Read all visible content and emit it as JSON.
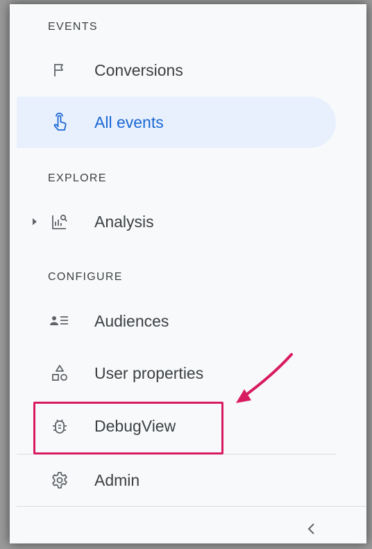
{
  "sections": {
    "events": "EVENTS",
    "explore": "EXPLORE",
    "configure": "CONFIGURE"
  },
  "nav": {
    "conversions": {
      "label": "Conversions",
      "icon": "flag-icon"
    },
    "all_events": {
      "label": "All events",
      "icon": "touch-icon",
      "active": true
    },
    "analysis": {
      "label": "Analysis",
      "icon": "analysis-icon"
    },
    "audiences": {
      "label": "Audiences",
      "icon": "audience-list-icon"
    },
    "user_properties": {
      "label": "User properties",
      "icon": "shapes-icon"
    },
    "debugview": {
      "label": "DebugView",
      "icon": "bug-icon"
    },
    "admin": {
      "label": "Admin",
      "icon": "gear-icon"
    }
  },
  "colors": {
    "active_bg": "#e8f0fe",
    "active_text": "#1967d2",
    "highlight": "#d81b60",
    "text": "#3c4043"
  }
}
